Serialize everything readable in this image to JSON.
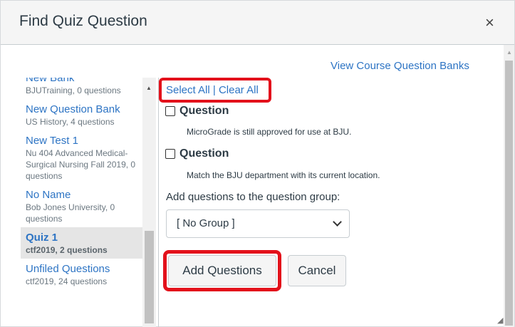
{
  "dialog": {
    "title": "Find Quiz Question",
    "close_glyph": "×",
    "view_banks_link": "View Course Question Banks"
  },
  "bank_list": {
    "items": [
      {
        "name": "New Bank",
        "meta": "BJUTraining, 0 questions",
        "selected": false
      },
      {
        "name": "New Question Bank",
        "meta": "US History, 4 questions",
        "selected": false
      },
      {
        "name": "New Test 1",
        "meta": "Nu 404 Advanced Medical-Surgical Nursing Fall 2019, 0 questions",
        "selected": false
      },
      {
        "name": "No Name",
        "meta": "Bob Jones University, 0 questions",
        "selected": false
      },
      {
        "name": "Quiz 1",
        "meta": "ctf2019, 2 questions",
        "selected": true
      },
      {
        "name": "Unfiled Questions",
        "meta": "ctf2019, 24 questions",
        "selected": false
      }
    ]
  },
  "selection": {
    "select_all": "Select All",
    "separator": " | ",
    "clear_all": "Clear All"
  },
  "questions": [
    {
      "title": "Question",
      "text": "MicroGrade is still approved for use at BJU.",
      "checked": false
    },
    {
      "title": "Question",
      "text": "Match the BJU department with its current location.",
      "checked": false
    }
  ],
  "group": {
    "label": "Add questions to the question group:",
    "selected": "[ No Group ]"
  },
  "buttons": {
    "add": "Add Questions",
    "cancel": "Cancel"
  },
  "colors": {
    "link": "#2d74c4",
    "highlight_box": "#e3111b",
    "selected_item_bg": "#e5e5e5"
  }
}
